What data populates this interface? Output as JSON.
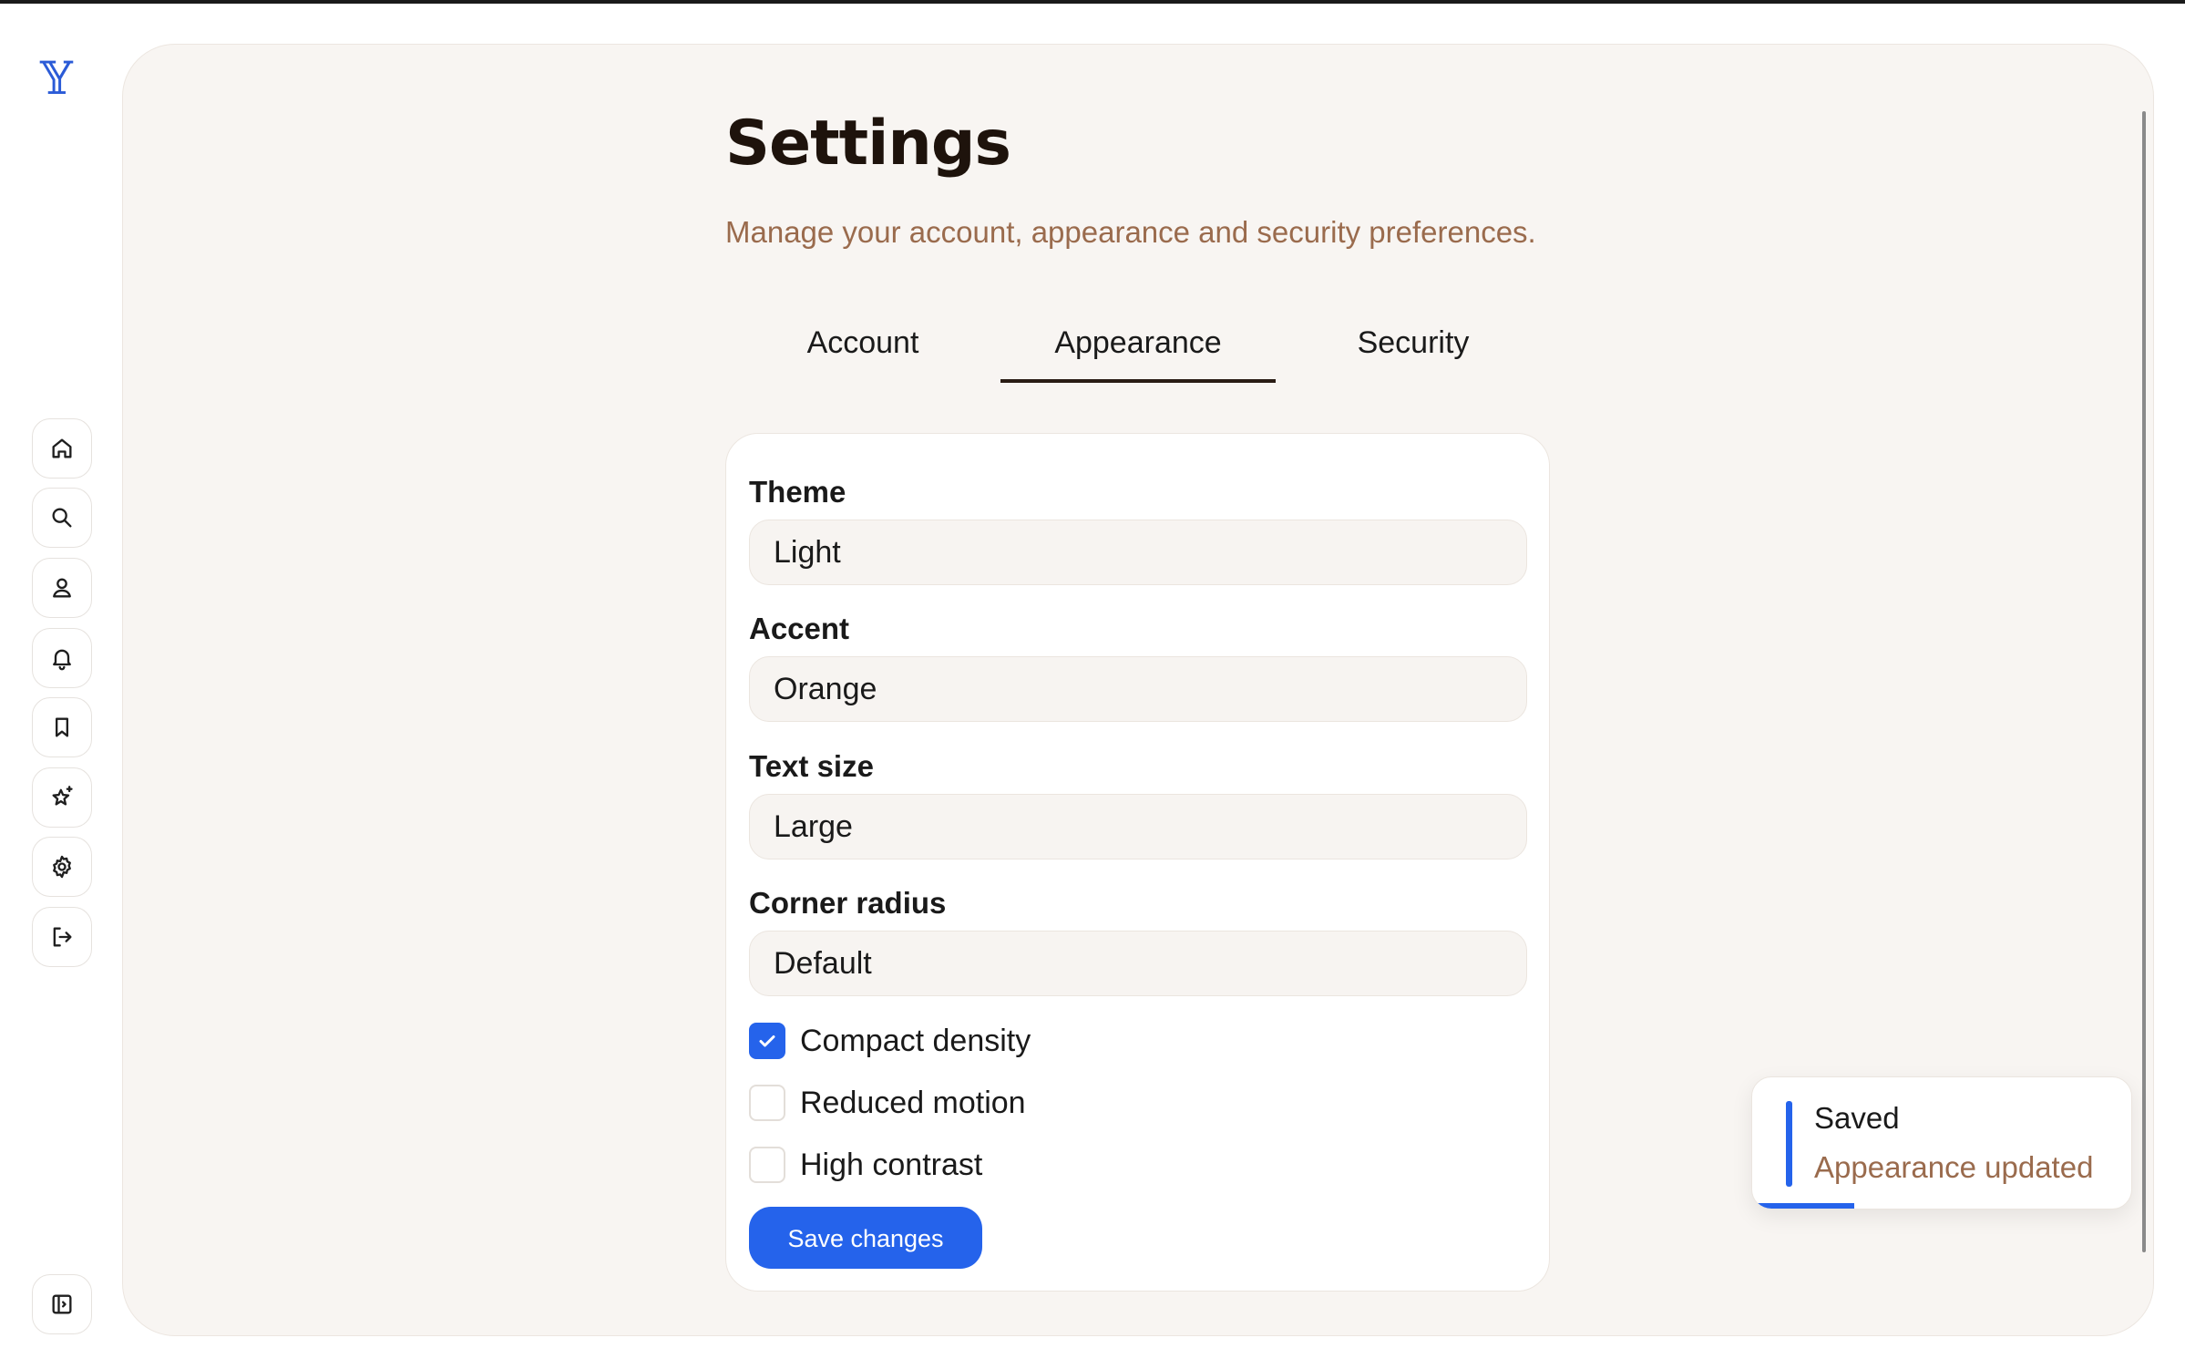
{
  "app": {
    "logo_glyph": "𝕐",
    "accent_color": "#2563eb"
  },
  "rail": {
    "items": [
      {
        "name": "home",
        "icon": "home-icon"
      },
      {
        "name": "search",
        "icon": "search-icon"
      },
      {
        "name": "profile",
        "icon": "user-icon"
      },
      {
        "name": "notifications",
        "icon": "bell-icon"
      },
      {
        "name": "bookmarks",
        "icon": "bookmark-icon"
      },
      {
        "name": "favorites",
        "icon": "sparkle-star-icon"
      },
      {
        "name": "settings",
        "icon": "gear-icon"
      },
      {
        "name": "logout",
        "icon": "logout-icon"
      }
    ],
    "collapse_icon": "sidebar-collapse-icon"
  },
  "page": {
    "title": "Settings",
    "subtitle": "Manage your account, appearance and security preferences."
  },
  "tabs": [
    {
      "label": "Account",
      "active": false
    },
    {
      "label": "Appearance",
      "active": true
    },
    {
      "label": "Security",
      "active": false
    }
  ],
  "form": {
    "fields": [
      {
        "label": "Theme",
        "value": "Light"
      },
      {
        "label": "Accent",
        "value": "Orange"
      },
      {
        "label": "Text size",
        "value": "Large"
      },
      {
        "label": "Corner radius",
        "value": "Default"
      }
    ],
    "checkboxes": [
      {
        "label": "Compact density",
        "checked": true
      },
      {
        "label": "Reduced motion",
        "checked": false
      },
      {
        "label": "High contrast",
        "checked": false
      }
    ],
    "save_label": "Save changes"
  },
  "toast": {
    "title": "Saved",
    "message": "Appearance updated",
    "progress_fraction": 0.27
  }
}
